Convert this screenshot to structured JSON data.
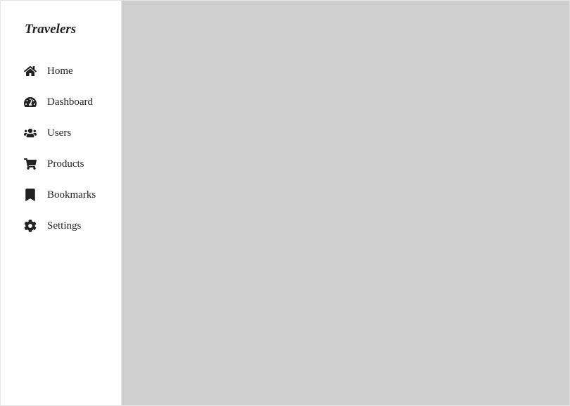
{
  "brand": "Travelers",
  "sidebar": {
    "items": [
      {
        "label": "Home",
        "icon": "home-icon"
      },
      {
        "label": "Dashboard",
        "icon": "dashboard-icon"
      },
      {
        "label": "Users",
        "icon": "users-icon"
      },
      {
        "label": "Products",
        "icon": "cart-icon"
      },
      {
        "label": "Bookmarks",
        "icon": "bookmark-icon"
      },
      {
        "label": "Settings",
        "icon": "gear-icon"
      }
    ]
  }
}
